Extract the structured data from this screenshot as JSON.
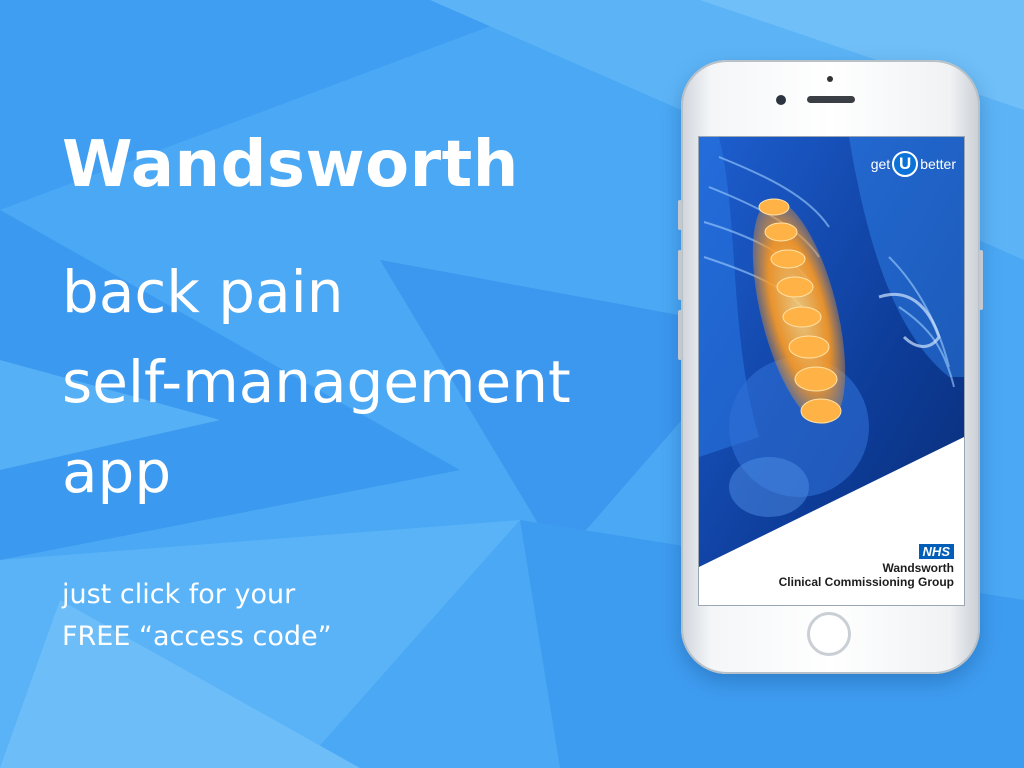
{
  "headline": {
    "title": "Wandsworth",
    "line1": "back pain",
    "line2": "self-management",
    "line3": "app"
  },
  "cta": {
    "line1": "just click for your",
    "line2": "FREE “access code”"
  },
  "phone_screen": {
    "logo_get": "get",
    "logo_u": "U",
    "logo_better": "better",
    "nhs_badge": "NHS",
    "org_line1": "Wandsworth",
    "org_line2": "Clinical Commissioning Group"
  },
  "colors": {
    "background": "#4aa8f4",
    "nhs_blue": "#005eb8",
    "spine_highlight": "#ff9a1f"
  }
}
